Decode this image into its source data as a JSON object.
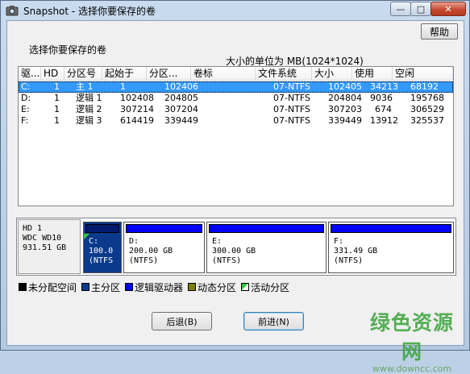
{
  "window": {
    "title": "Snapshot - 选择你要保存的卷",
    "min_glyph": "—",
    "max_glyph": "□",
    "close_glyph": "✕"
  },
  "dialog": {
    "help_label": "帮助",
    "choose_label": "选择你要保存的卷",
    "unit_label": "大小的单位为 MB(1024*1024)"
  },
  "volumes": {
    "columns": [
      "驱...",
      "HD",
      "分区号",
      "起始于",
      "分区...",
      "卷标",
      "文件系统",
      "大小",
      "使用",
      "空闲"
    ],
    "rows": [
      [
        "C:",
        "1",
        "主 1",
        "1",
        "102406",
        "",
        "07-NTFS",
        "102405",
        "34213",
        "68192"
      ],
      [
        "D:",
        "1",
        "逻辑 1",
        "102408",
        "204805",
        "",
        "07-NTFS",
        "204804",
        "9036",
        "195768"
      ],
      [
        "E:",
        "1",
        "逻辑 2",
        "307214",
        "307204",
        "",
        "07-NTFS",
        "307203",
        "674",
        "306529"
      ],
      [
        "F:",
        "1",
        "逻辑 3",
        "614419",
        "339449",
        "",
        "07-NTFS",
        "339449",
        "13912",
        "325537"
      ]
    ],
    "selected_row": 0
  },
  "disk": {
    "line1": "HD 1",
    "line2": "WDC WD10",
    "line3": "931.51 GB",
    "partitions": [
      {
        "l1": "C:",
        "l2": "100.0",
        "l3": "(NTFS"
      },
      {
        "l1": "D:",
        "l2": "200.00 GB",
        "l3": "(NTFS)"
      },
      {
        "l1": "E:",
        "l2": "300.00 GB",
        "l3": "(NTFS)"
      },
      {
        "l1": "F:",
        "l2": "331.49 GB",
        "l3": "(NTFS)"
      }
    ]
  },
  "legend": {
    "unallocated": "未分配空间",
    "primary": "主分区",
    "logical": "逻辑驱动器",
    "dynamic": "动态分区",
    "active": "活动分区",
    "colors": {
      "unallocated": "#000000",
      "primary": "#0b3a8c",
      "logical": "#0000ff",
      "dynamic": "#808000",
      "active": "#2ecc40"
    }
  },
  "buttons": {
    "back": "后退(B)",
    "next": "前进(N)"
  },
  "watermark": {
    "big": "绿色资源网",
    "small": "www.downcc.com"
  }
}
